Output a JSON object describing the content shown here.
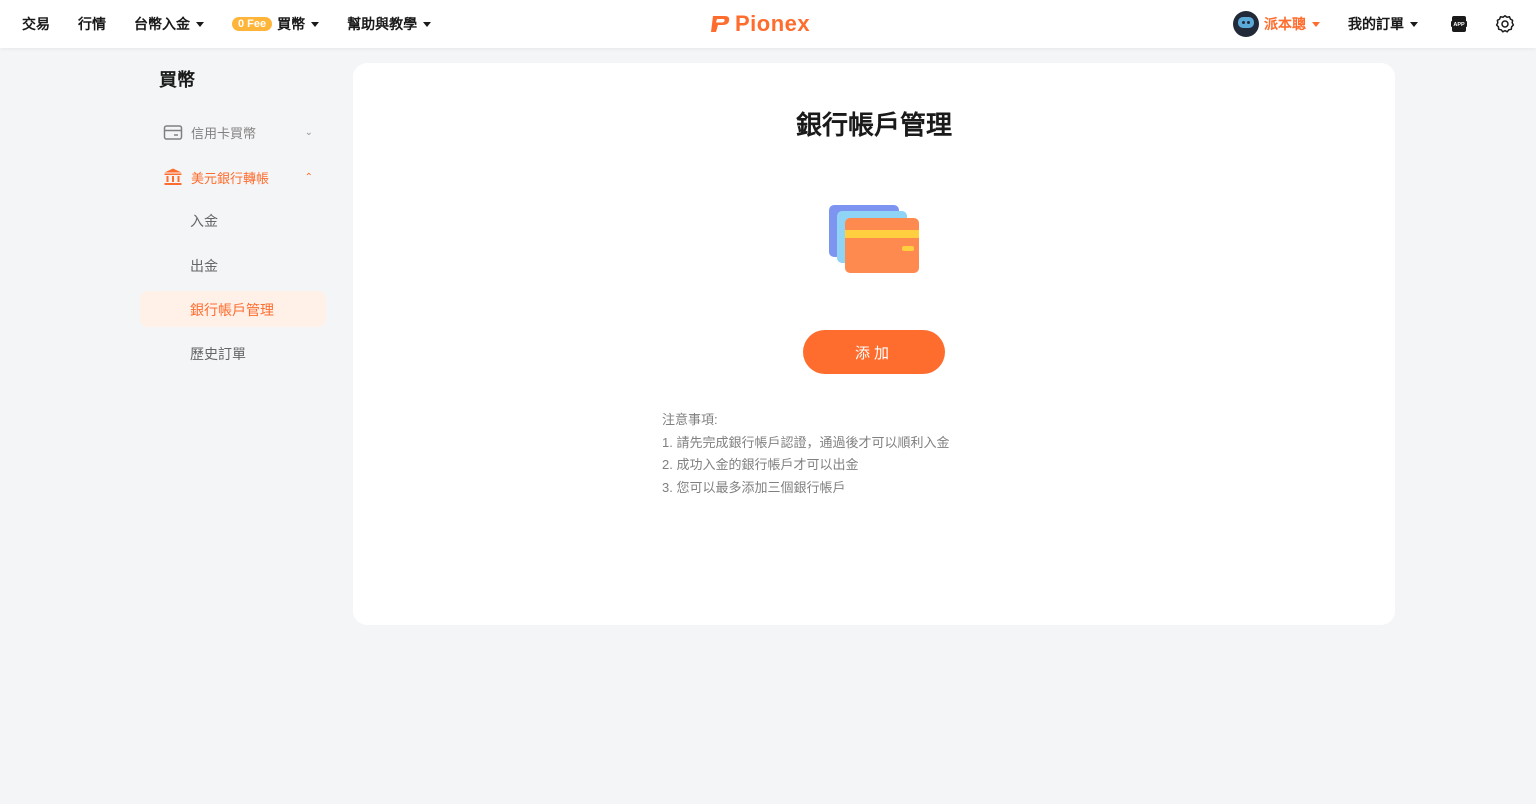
{
  "nav": {
    "trade": "交易",
    "market": "行情",
    "twd_deposit": "台幣入金",
    "fee_badge": "0 Fee",
    "buy_crypto": "買幣",
    "help": "幫助與教學",
    "logo": "Pionex",
    "user_name": "派本聰",
    "my_orders": "我的訂單"
  },
  "icons": {
    "app": "app-download-icon",
    "settings": "gear-icon"
  },
  "sidebar": {
    "title": "買幣",
    "groups": [
      {
        "label": "信用卡買幣",
        "icon": "credit-card-icon",
        "expanded": false
      },
      {
        "label": "美元銀行轉帳",
        "icon": "bank-icon",
        "expanded": true
      }
    ],
    "sub_items": [
      "入金",
      "出金",
      "銀行帳戶管理",
      "歷史訂單"
    ],
    "active": "銀行帳戶管理"
  },
  "main": {
    "title": "銀行帳戶管理",
    "add_button": "添加",
    "notes_title": "注意事項:",
    "notes": [
      "1. 請先完成銀行帳戶認證，通過後才可以順利入金",
      "2. 成功入金的銀行帳戶才可以出金",
      "3. 您可以最多添加三個銀行帳戶"
    ]
  },
  "colors": {
    "accent": "#ff6d2e",
    "badge": "#ffb53a",
    "active_bg": "#fff0e8",
    "page_bg": "#f4f5f7"
  }
}
